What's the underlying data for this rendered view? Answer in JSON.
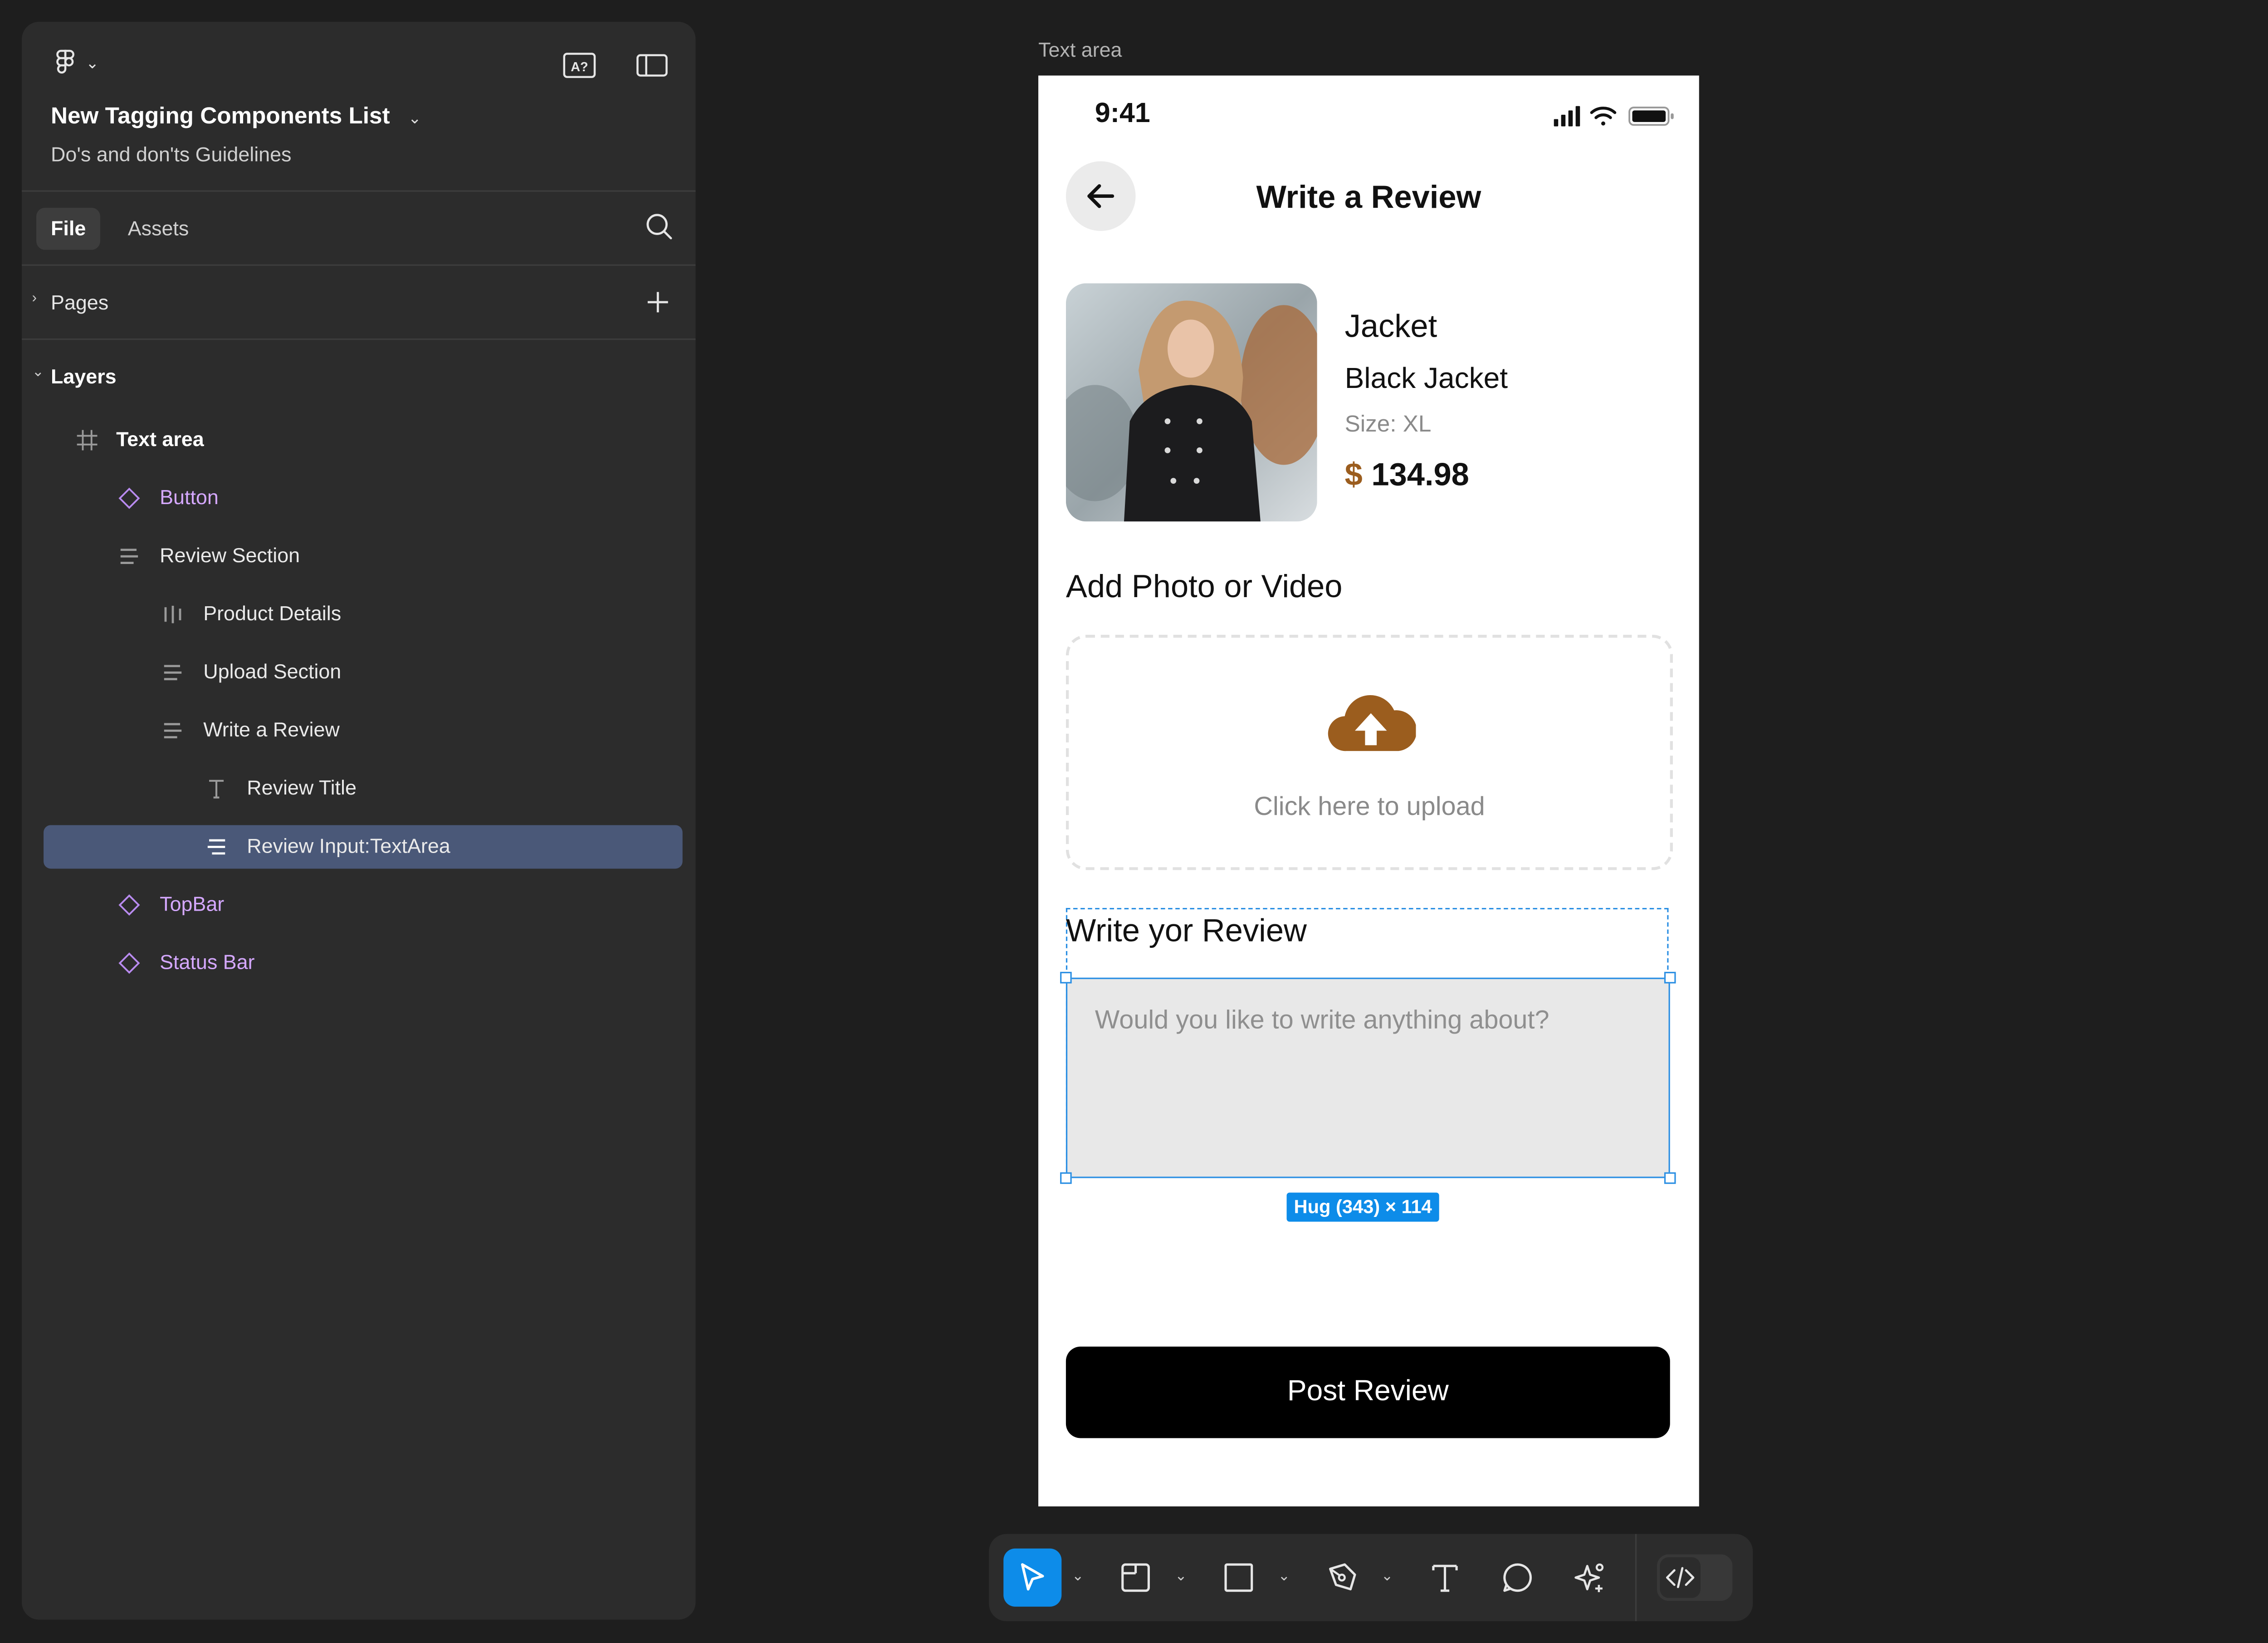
{
  "panel": {
    "file_title": "New Tagging Components List",
    "file_subtitle": "Do's and don'ts Guidelines",
    "tabs": [
      {
        "label": "File",
        "active": true
      },
      {
        "label": "Assets",
        "active": false
      }
    ],
    "pages_label": "Pages",
    "layers_label": "Layers",
    "layers": [
      {
        "label": "Text area",
        "icon": "frame-icon",
        "kind": "frame"
      },
      {
        "label": "Button",
        "icon": "component-icon",
        "kind": "component"
      },
      {
        "label": "Review Section",
        "icon": "vertical-autolayout-icon",
        "kind": "autolayout"
      },
      {
        "label": "Product Details",
        "icon": "horizontal-autolayout-icon",
        "kind": "autolayout"
      },
      {
        "label": "Upload Section",
        "icon": "vertical-autolayout-icon",
        "kind": "autolayout"
      },
      {
        "label": "Write a Review",
        "icon": "vertical-autolayout-icon",
        "kind": "autolayout"
      },
      {
        "label": "Review Title",
        "icon": "text-icon",
        "kind": "text"
      },
      {
        "label": "Review Input:TextArea",
        "icon": "vertical-autolayout-icon",
        "kind": "autolayout",
        "selected": true
      },
      {
        "label": "TopBar",
        "icon": "component-icon",
        "kind": "component"
      },
      {
        "label": "Status Bar",
        "icon": "component-icon",
        "kind": "component"
      }
    ]
  },
  "canvas": {
    "frame_label": "Text area",
    "selection_size": "Hug (343) × 114"
  },
  "mobile": {
    "status_time": "9:41",
    "page_title": "Write a Review",
    "product": {
      "name": "Jacket",
      "subtitle": "Black Jacket",
      "size": "Size: XL",
      "currency": "$",
      "price": "134.98"
    },
    "upload_title": "Add Photo or Video",
    "upload_hint": "Click here to upload",
    "review_title": "Write yor Review",
    "review_placeholder": "Would you like to write anything about?",
    "post_button": "Post Review"
  },
  "colors": {
    "accent_brown": "#9b5d1e",
    "selection_blue": "#0d8ce9",
    "component_purple": "#d5a8ff",
    "panel_bg": "#2c2c2c",
    "canvas_bg": "#1e1e1e"
  }
}
